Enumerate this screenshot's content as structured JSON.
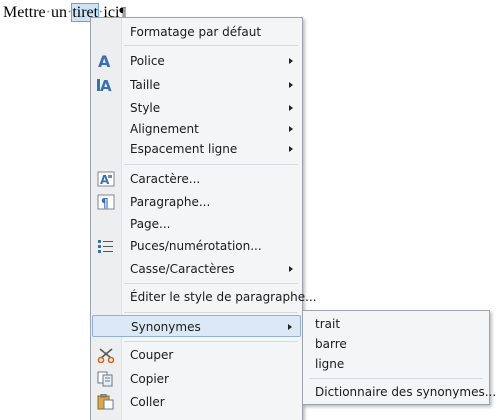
{
  "document": {
    "words": [
      "Mettre",
      "un",
      "tiret",
      "ici"
    ],
    "separator": "·",
    "pilcrow": "¶"
  },
  "context_menu": {
    "items": [
      {
        "label": "Formatage par défaut",
        "submenu": false,
        "icon": null
      },
      {
        "label": "Police",
        "submenu": true,
        "icon": "font-icon"
      },
      {
        "label": "Taille",
        "submenu": true,
        "icon": "font-size-icon"
      },
      {
        "label": "Style",
        "submenu": true,
        "icon": null
      },
      {
        "label": "Alignement",
        "submenu": true,
        "icon": null
      },
      {
        "label": "Espacement ligne",
        "submenu": true,
        "icon": null
      },
      {
        "label": "Caractère...",
        "submenu": false,
        "icon": "character-icon"
      },
      {
        "label": "Paragraphe...",
        "submenu": false,
        "icon": "paragraph-icon"
      },
      {
        "label": "Page...",
        "submenu": false,
        "icon": null
      },
      {
        "label": "Puces/numérotation...",
        "submenu": false,
        "icon": "bullets-icon"
      },
      {
        "label": "Casse/Caractères",
        "submenu": true,
        "icon": null
      },
      {
        "label": "Éditer le style de paragraphe...",
        "submenu": false,
        "icon": null
      },
      {
        "label": "Synonymes",
        "submenu": true,
        "icon": null,
        "highlighted": true
      },
      {
        "label": "Couper",
        "submenu": false,
        "icon": "scissors-icon"
      },
      {
        "label": "Copier",
        "submenu": false,
        "icon": "copy-icon"
      },
      {
        "label": "Coller",
        "submenu": false,
        "icon": "paste-icon"
      }
    ]
  },
  "synonyms_menu": {
    "items": [
      "trait",
      "barre",
      "ligne"
    ],
    "dictionary_label": "Dictionnaire des synonymes..."
  },
  "colors": {
    "menu_bg": "#f4f5f6",
    "highlight_bg": "#dbe8f6",
    "highlight_border": "#8fb0d8",
    "selection_bg": "#cfe3f7",
    "icon_blue": "#3a6fb0"
  }
}
